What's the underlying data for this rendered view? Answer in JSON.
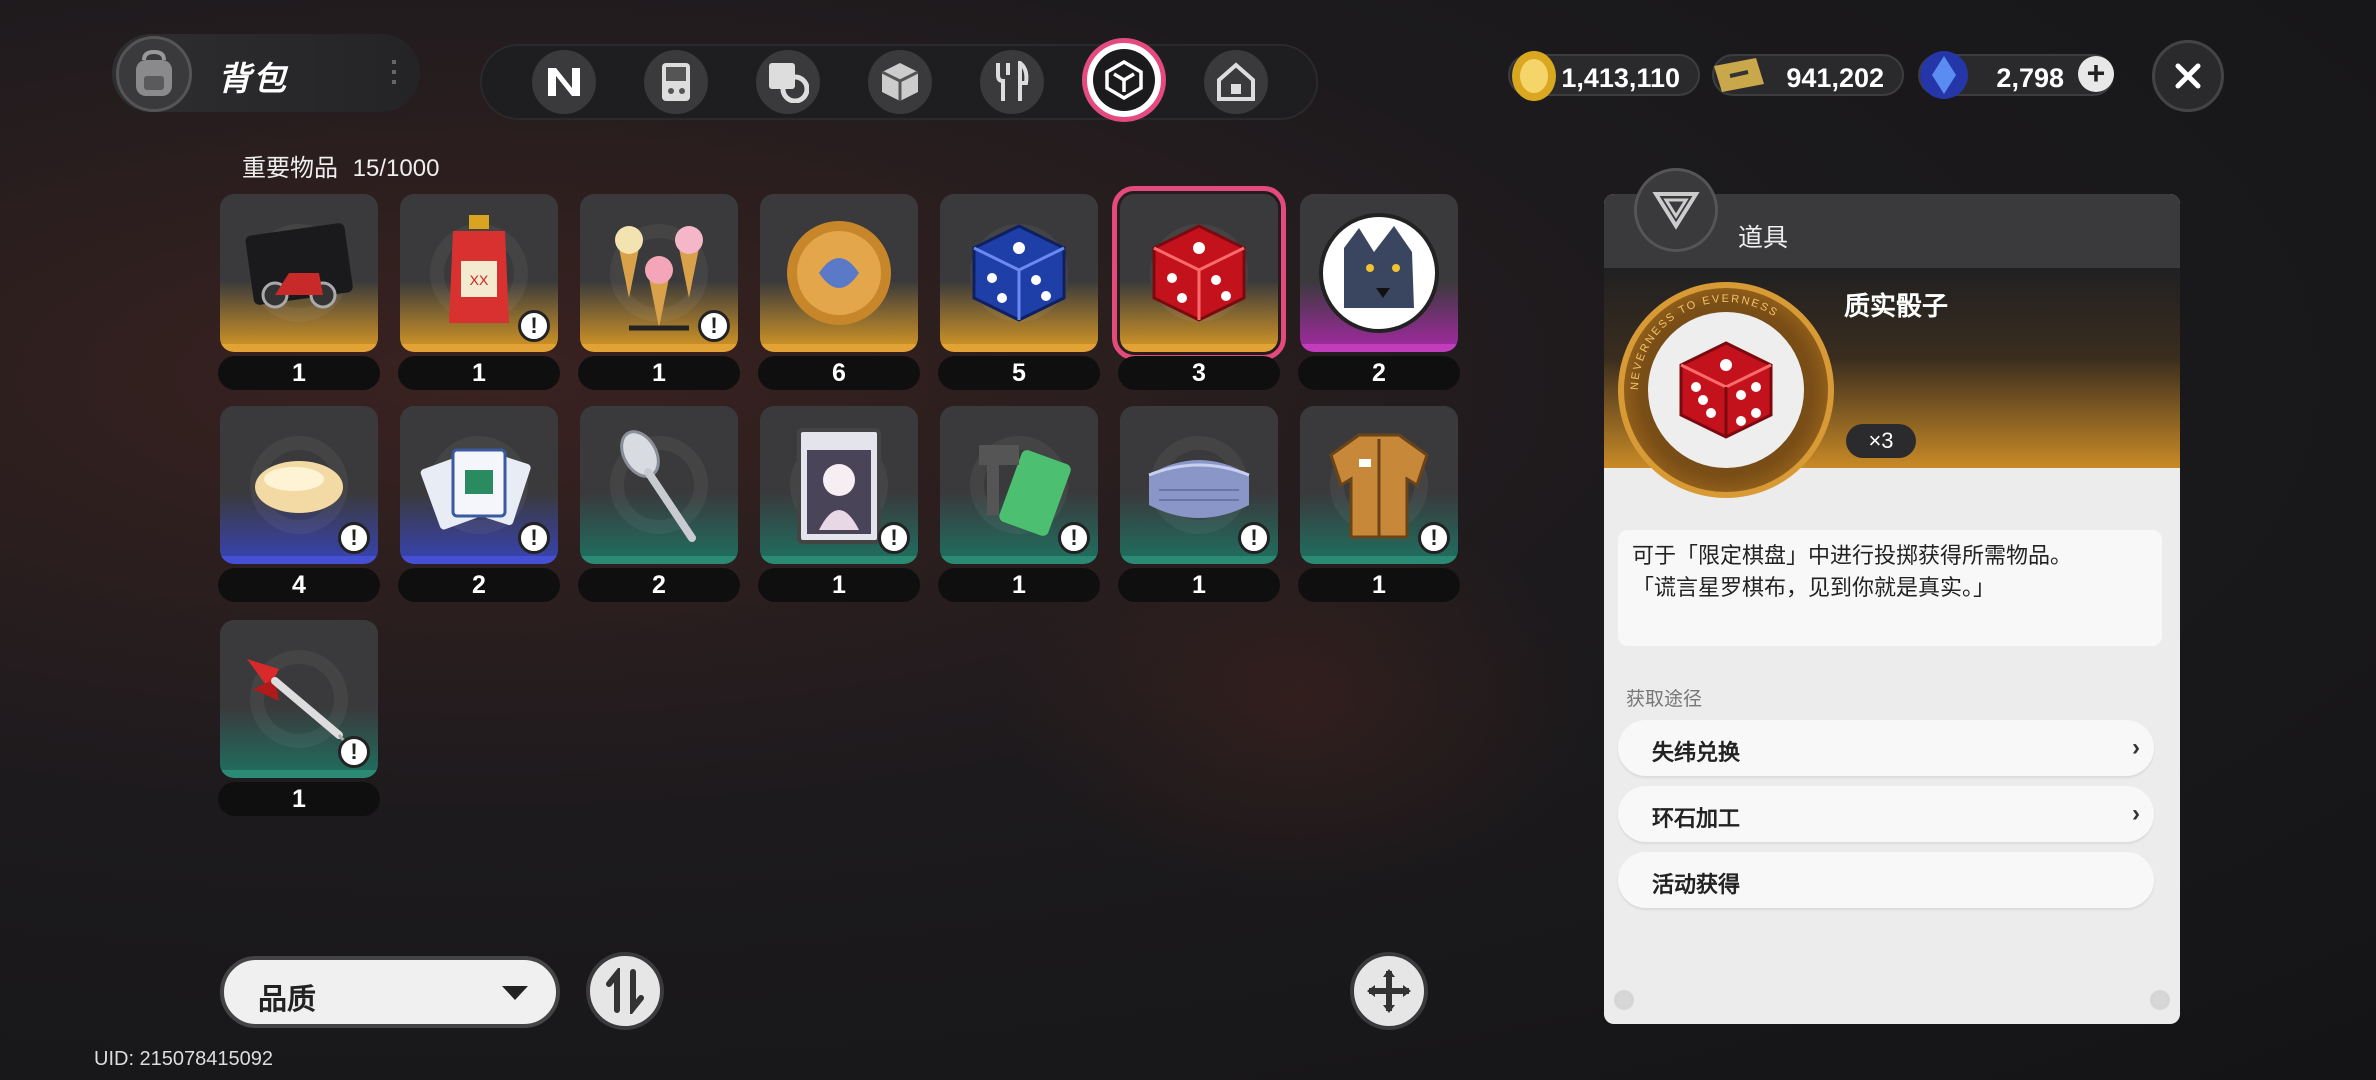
{
  "header": {
    "title": "背包",
    "tabs": [
      {
        "name": "tab-n-icon",
        "active": false
      },
      {
        "name": "tab-console-icon",
        "active": false
      },
      {
        "name": "tab-disk-icon",
        "active": false
      },
      {
        "name": "tab-box-icon",
        "active": false
      },
      {
        "name": "tab-food-icon",
        "active": false
      },
      {
        "name": "tab-key-items-icon",
        "active": true
      },
      {
        "name": "tab-home-icon",
        "active": false
      }
    ]
  },
  "currency": {
    "gold": "1,413,110",
    "ticket": "941,202",
    "gem": "2,798"
  },
  "inventory": {
    "label": "重要物品",
    "count": "15/1000",
    "items": [
      {
        "name": "scooter-card",
        "quality": "gold",
        "count": "1",
        "alert": false
      },
      {
        "name": "drink-pouch",
        "quality": "gold",
        "count": "1",
        "alert": true
      },
      {
        "name": "ice-cream-stand",
        "quality": "gold",
        "count": "1",
        "alert": true
      },
      {
        "name": "gold-coin",
        "quality": "gold",
        "count": "6",
        "alert": false
      },
      {
        "name": "blue-dice",
        "quality": "gold",
        "count": "5",
        "alert": false
      },
      {
        "name": "red-dice",
        "quality": "gold",
        "count": "3",
        "alert": false,
        "selected": true
      },
      {
        "name": "wolf-portrait",
        "quality": "purple",
        "count": "2",
        "alert": false
      },
      {
        "name": "soap-bar",
        "quality": "blue",
        "count": "4",
        "alert": true
      },
      {
        "name": "card-pile",
        "quality": "blue",
        "count": "2",
        "alert": true
      },
      {
        "name": "spoon",
        "quality": "green",
        "count": "2",
        "alert": false
      },
      {
        "name": "figure-box",
        "quality": "green",
        "count": "1",
        "alert": true
      },
      {
        "name": "tag-key",
        "quality": "green",
        "count": "1",
        "alert": true
      },
      {
        "name": "folded-towel",
        "quality": "green",
        "count": "1",
        "alert": true
      },
      {
        "name": "work-jacket",
        "quality": "green",
        "count": "1",
        "alert": true
      },
      {
        "name": "dart",
        "quality": "green",
        "count": "1",
        "alert": true
      }
    ],
    "alert_glyph": "!"
  },
  "controls": {
    "sort_label": "品质",
    "uid": "UID: 215078415092"
  },
  "detail": {
    "category": "道具",
    "item_name": "质实骰子",
    "quantity": "×3",
    "medal_text": "NEVERNESS TO EVERNESS",
    "description_line1": "可于「限定棋盘」中进行投掷获得所需物品。",
    "description_line2": "「谎言星罗棋布，见到你就是真实。」",
    "sources_title": "获取途径",
    "sources": [
      {
        "label": "失纬兑换",
        "chevron": true
      },
      {
        "label": "环石加工",
        "chevron": true
      },
      {
        "label": "活动获得",
        "chevron": false
      }
    ],
    "chevron_glyph": "›"
  },
  "colors": {
    "accent": "#e34a7e",
    "gold_quality": "#e3a235",
    "purple_quality": "#c23dbb",
    "blue_quality": "#4551d4",
    "green_quality": "#2a8a74"
  }
}
